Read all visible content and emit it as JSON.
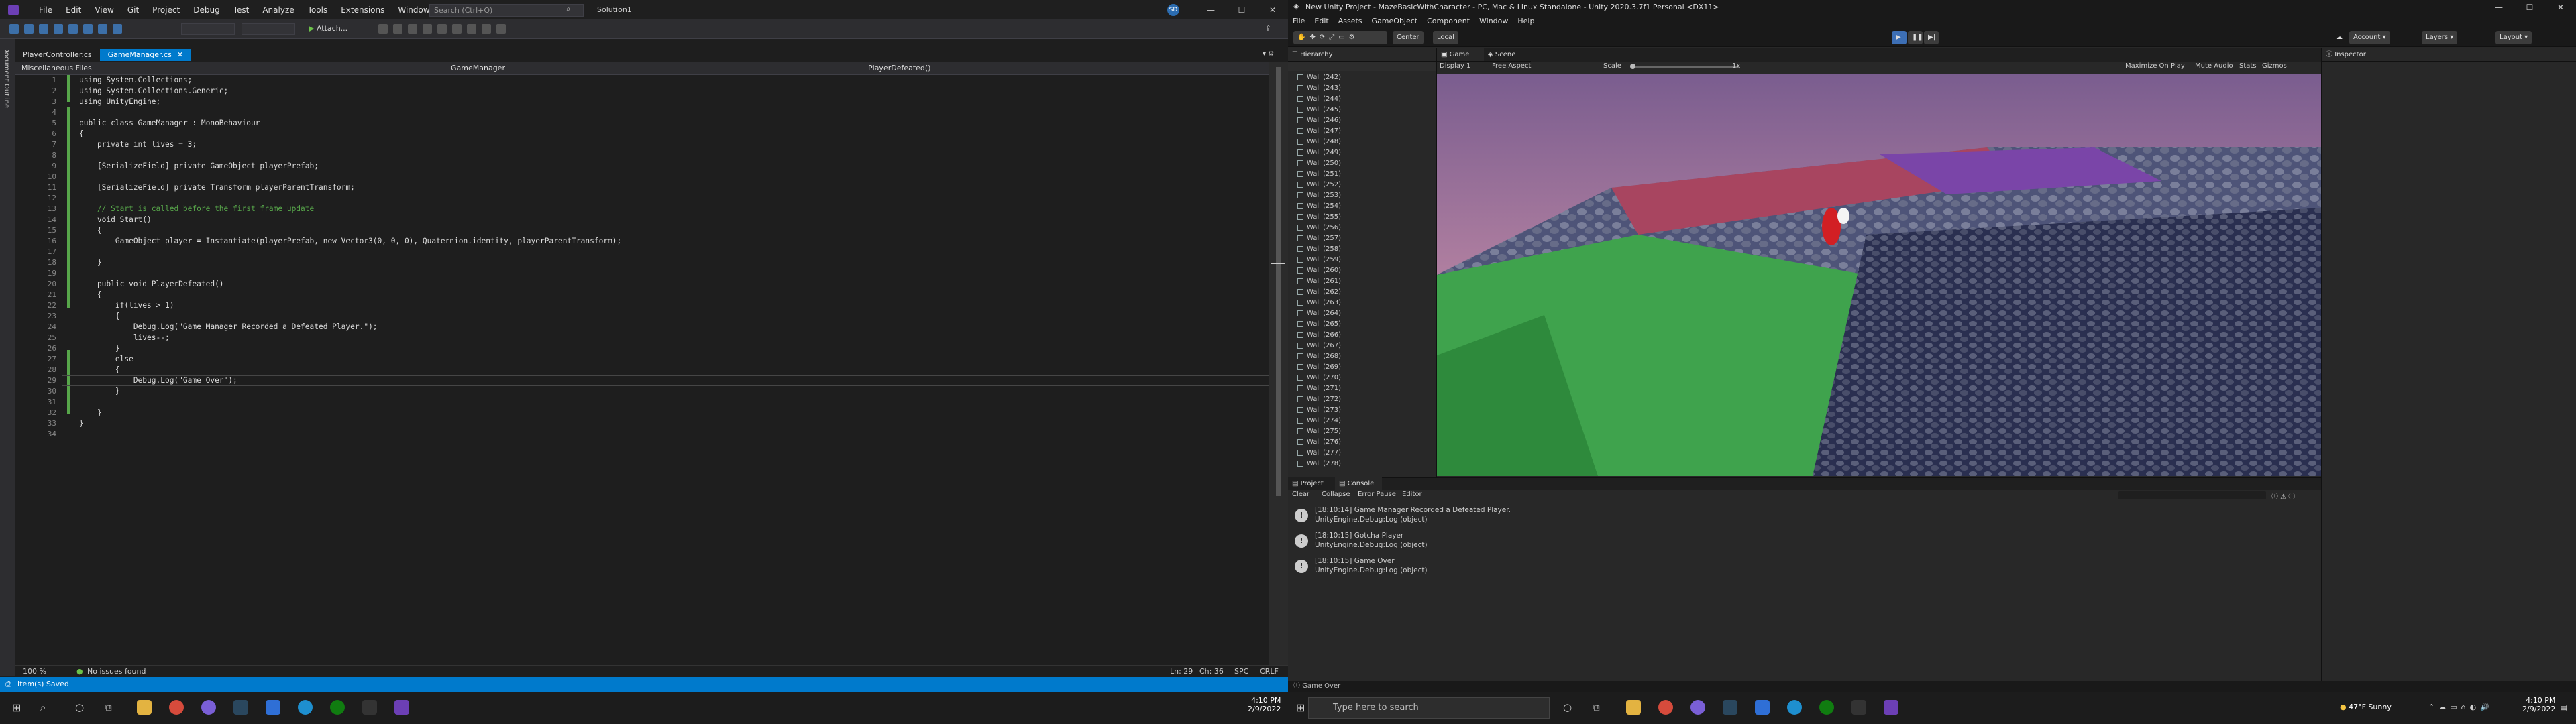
{
  "vs": {
    "menu": [
      "File",
      "Edit",
      "View",
      "Git",
      "Project",
      "Debug",
      "Test",
      "Analyze",
      "Tools",
      "Extensions",
      "Window",
      "Help"
    ],
    "search_placeholder": "Search (Ctrl+Q)",
    "solution": "Solution1",
    "avatar": "SD",
    "attach": "Attach...",
    "tabs": [
      "PlayerController.cs",
      "GameManager.cs"
    ],
    "side_label": "Document Outline",
    "nav": {
      "project": "Miscellaneous Files",
      "class": "GameManager",
      "member": "PlayerDefeated()"
    },
    "line_numbers": [
      "1",
      "2",
      "3",
      "4",
      "5",
      "6",
      "7",
      "8",
      "9",
      "10",
      "11",
      "12",
      "13",
      "14",
      "15",
      "16",
      "17",
      "18",
      "19",
      "20",
      "21",
      "22",
      "23",
      "24",
      "25",
      "26",
      "27",
      "28",
      "29",
      "30",
      "31",
      "32",
      "33",
      "34"
    ],
    "code": [
      "using System.Collections;",
      "using System.Collections.Generic;",
      "using UnityEngine;",
      "",
      "public class GameManager : MonoBehaviour",
      "{",
      "    private int lives = 3;",
      "",
      "    [SerializeField] private GameObject playerPrefab;",
      "",
      "    [SerializeField] private Transform playerParentTransform;",
      "",
      "    // Start is called before the first frame update",
      "    void Start()",
      "    {",
      "        GameObject player = Instantiate(playerPrefab, new Vector3(0, 0, 0), Quaternion.identity, playerParentTransform);",
      "",
      "    }",
      "",
      "    public void PlayerDefeated()",
      "    {",
      "        if(lives > 1)",
      "        {",
      "            Debug.Log(\"Game Manager Recorded a Defeated Player.\");",
      "            lives--;",
      "        }",
      "        else",
      "        {",
      "            Debug.Log(\"Game Over\");",
      "        }",
      "",
      "    }",
      "}",
      ""
    ],
    "status": {
      "zoom": "100 %",
      "issues": "No issues found",
      "ln": "Ln: 29",
      "ch": "Ch: 36",
      "spc": "SPC",
      "crlf": "CRLF",
      "saved": "Item(s) Saved"
    }
  },
  "unity": {
    "title": "New Unity Project - MazeBasicWithCharacter - PC, Mac & Linux Standalone - Unity 2020.3.7f1 Personal <DX11>",
    "menu": [
      "File",
      "Edit",
      "Assets",
      "GameObject",
      "Component",
      "Window",
      "Help"
    ],
    "toolbar": {
      "center": "Center",
      "local": "Local",
      "account": "Account",
      "layers": "Layers",
      "layout": "Layout"
    },
    "hierarchy_tab": "Hierarchy",
    "hierarchy_items": [
      "Wall (242)",
      "Wall (243)",
      "Wall (244)",
      "Wall (245)",
      "Wall (246)",
      "Wall (247)",
      "Wall (248)",
      "Wall (249)",
      "Wall (250)",
      "Wall (251)",
      "Wall (252)",
      "Wall (253)",
      "Wall (254)",
      "Wall (255)",
      "Wall (256)",
      "Wall (257)",
      "Wall (258)",
      "Wall (259)",
      "Wall (260)",
      "Wall (261)",
      "Wall (262)",
      "Wall (263)",
      "Wall (264)",
      "Wall (265)",
      "Wall (266)",
      "Wall (267)",
      "Wall (268)",
      "Wall (269)",
      "Wall (270)",
      "Wall (271)",
      "Wall (272)",
      "Wall (273)",
      "Wall (274)",
      "Wall (275)",
      "Wall (276)",
      "Wall (277)",
      "Wall (278)"
    ],
    "game_tabs": [
      "Game",
      "Scene"
    ],
    "game_bar": {
      "display": "Display 1",
      "aspect": "Free Aspect",
      "scale": "Scale",
      "scale_value": "1x",
      "maximize": "Maximize On Play",
      "mute": "Mute Audio",
      "stats": "Stats",
      "gizmos": "Gizmos"
    },
    "inspector_tab": "Inspector",
    "bottom_tabs": [
      "Project",
      "Console"
    ],
    "console_bar": {
      "clear": "Clear",
      "collapse": "Collapse",
      "error_pause": "Error Pause",
      "editor": "Editor"
    },
    "console_logs": [
      {
        "msg": "[18:10:14] Game Manager Recorded a Defeated Player.",
        "detail": "UnityEngine.Debug:Log (object)"
      },
      {
        "msg": "[18:10:15] Gotcha Player",
        "detail": "UnityEngine.Debug:Log (object)"
      },
      {
        "msg": "[18:10:15] Game Over",
        "detail": "UnityEngine.Debug:Log (object)"
      }
    ],
    "status": "Game Over"
  },
  "taskbar": {
    "left_time": "4:10 PM",
    "left_date": "2/9/2022",
    "search_placeholder": "Type here to search",
    "weather": "47°F  Sunny",
    "right_time": "4:10 PM",
    "right_date": "2/9/2022"
  }
}
